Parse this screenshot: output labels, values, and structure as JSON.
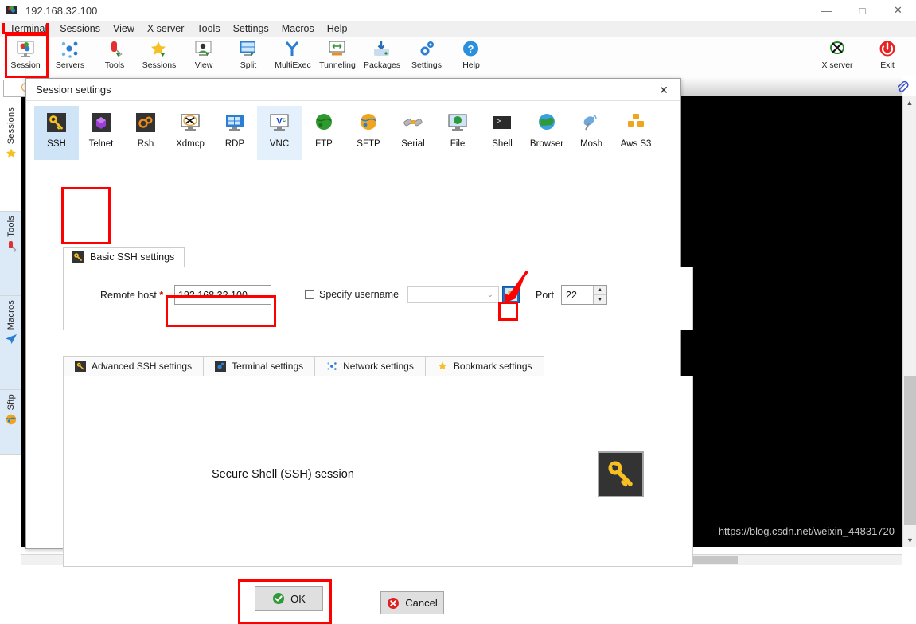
{
  "window": {
    "title": "192.168.32.100",
    "icon": "mobaxterm-icon",
    "minimize": "—",
    "maximize": "□",
    "close": "✕"
  },
  "menubar": {
    "items": [
      {
        "label": "Terminal",
        "name": "menu-terminal"
      },
      {
        "label": "Sessions",
        "name": "menu-sessions"
      },
      {
        "label": "View",
        "name": "menu-view"
      },
      {
        "label": "X server",
        "name": "menu-x-server"
      },
      {
        "label": "Tools",
        "name": "menu-tools"
      },
      {
        "label": "Settings",
        "name": "menu-settings"
      },
      {
        "label": "Macros",
        "name": "menu-macros"
      },
      {
        "label": "Help",
        "name": "menu-help"
      }
    ]
  },
  "toolbar": {
    "left_items": [
      {
        "label": "Session",
        "icon": "session-icon"
      },
      {
        "label": "Servers",
        "icon": "servers-icon"
      },
      {
        "label": "Tools",
        "icon": "tools-icon"
      },
      {
        "label": "Sessions",
        "icon": "sessions-star-icon"
      },
      {
        "label": "View",
        "icon": "view-icon"
      },
      {
        "label": "Split",
        "icon": "split-icon"
      },
      {
        "label": "MultiExec",
        "icon": "multiexec-icon"
      },
      {
        "label": "Tunneling",
        "icon": "tunneling-icon"
      },
      {
        "label": "Packages",
        "icon": "packages-icon"
      },
      {
        "label": "Settings",
        "icon": "settings-gear-icon"
      },
      {
        "label": "Help",
        "icon": "help-icon"
      }
    ],
    "right_items": [
      {
        "label": "X server",
        "icon": "x-server-icon"
      },
      {
        "label": "Exit",
        "icon": "exit-power-icon"
      }
    ]
  },
  "sidebar": {
    "collapse": "«",
    "tabs": [
      {
        "label": "Sessions",
        "icon": "star-icon"
      },
      {
        "label": "Tools",
        "icon": "knife-icon"
      },
      {
        "label": "Macros",
        "icon": "paper-plane-icon"
      },
      {
        "label": "Sftp",
        "icon": "globe-icon"
      }
    ]
  },
  "search": {
    "value": "",
    "placeholder": ""
  },
  "dialog": {
    "title": "Session settings",
    "close": "✕",
    "session_types": [
      {
        "label": "SSH",
        "icon": "ssh-key-icon",
        "state": "selected"
      },
      {
        "label": "Telnet",
        "icon": "telnet-icon",
        "state": "normal"
      },
      {
        "label": "Rsh",
        "icon": "rsh-icon",
        "state": "normal"
      },
      {
        "label": "Xdmcp",
        "icon": "xdmcp-icon",
        "state": "normal"
      },
      {
        "label": "RDP",
        "icon": "rdp-icon",
        "state": "normal"
      },
      {
        "label": "VNC",
        "icon": "vnc-icon",
        "state": "hover"
      },
      {
        "label": "FTP",
        "icon": "ftp-icon",
        "state": "normal"
      },
      {
        "label": "SFTP",
        "icon": "sftp-icon",
        "state": "normal"
      },
      {
        "label": "Serial",
        "icon": "serial-icon",
        "state": "normal"
      },
      {
        "label": "File",
        "icon": "file-icon",
        "state": "normal"
      },
      {
        "label": "Shell",
        "icon": "shell-icon",
        "state": "normal"
      },
      {
        "label": "Browser",
        "icon": "browser-icon",
        "state": "normal"
      },
      {
        "label": "Mosh",
        "icon": "mosh-icon",
        "state": "normal"
      },
      {
        "label": "Aws S3",
        "icon": "aws-s3-icon",
        "state": "normal"
      }
    ],
    "basic_group": {
      "tab_label": "Basic SSH settings",
      "tab_icon": "ssh-key-icon",
      "remote_host_label": "Remote host",
      "required_marker": "*",
      "remote_host_value": "192.168.32.100",
      "specify_username_label": "Specify username",
      "specify_username_checked": false,
      "username_value": "",
      "username_dropdown_arrow": "⌄",
      "user_browse_icon": "user-key-icon",
      "port_label": "Port",
      "port_value": "22",
      "spin_up": "▲",
      "spin_down": "▼"
    },
    "sub_tabs": [
      {
        "label": "Advanced SSH settings",
        "icon": "ssh-key-icon"
      },
      {
        "label": "Terminal settings",
        "icon": "terminal-settings-icon"
      },
      {
        "label": "Network settings",
        "icon": "network-icon"
      },
      {
        "label": "Bookmark settings",
        "icon": "star-icon"
      }
    ],
    "panel": {
      "description": "Secure Shell (SSH) session",
      "icon": "ssh-key-icon"
    },
    "buttons": {
      "ok": "OK",
      "ok_icon": "green-check-icon",
      "cancel": "Cancel",
      "cancel_icon": "red-x-icon"
    }
  },
  "watermark": "https://blog.csdn.net/weixin_44831720",
  "colors": {
    "annotation": "#fe0000",
    "selection": "#cfe5f7",
    "hover": "#e4f0fb",
    "accent_blue": "#1e6fc4",
    "terminal_bg": "#000000"
  }
}
